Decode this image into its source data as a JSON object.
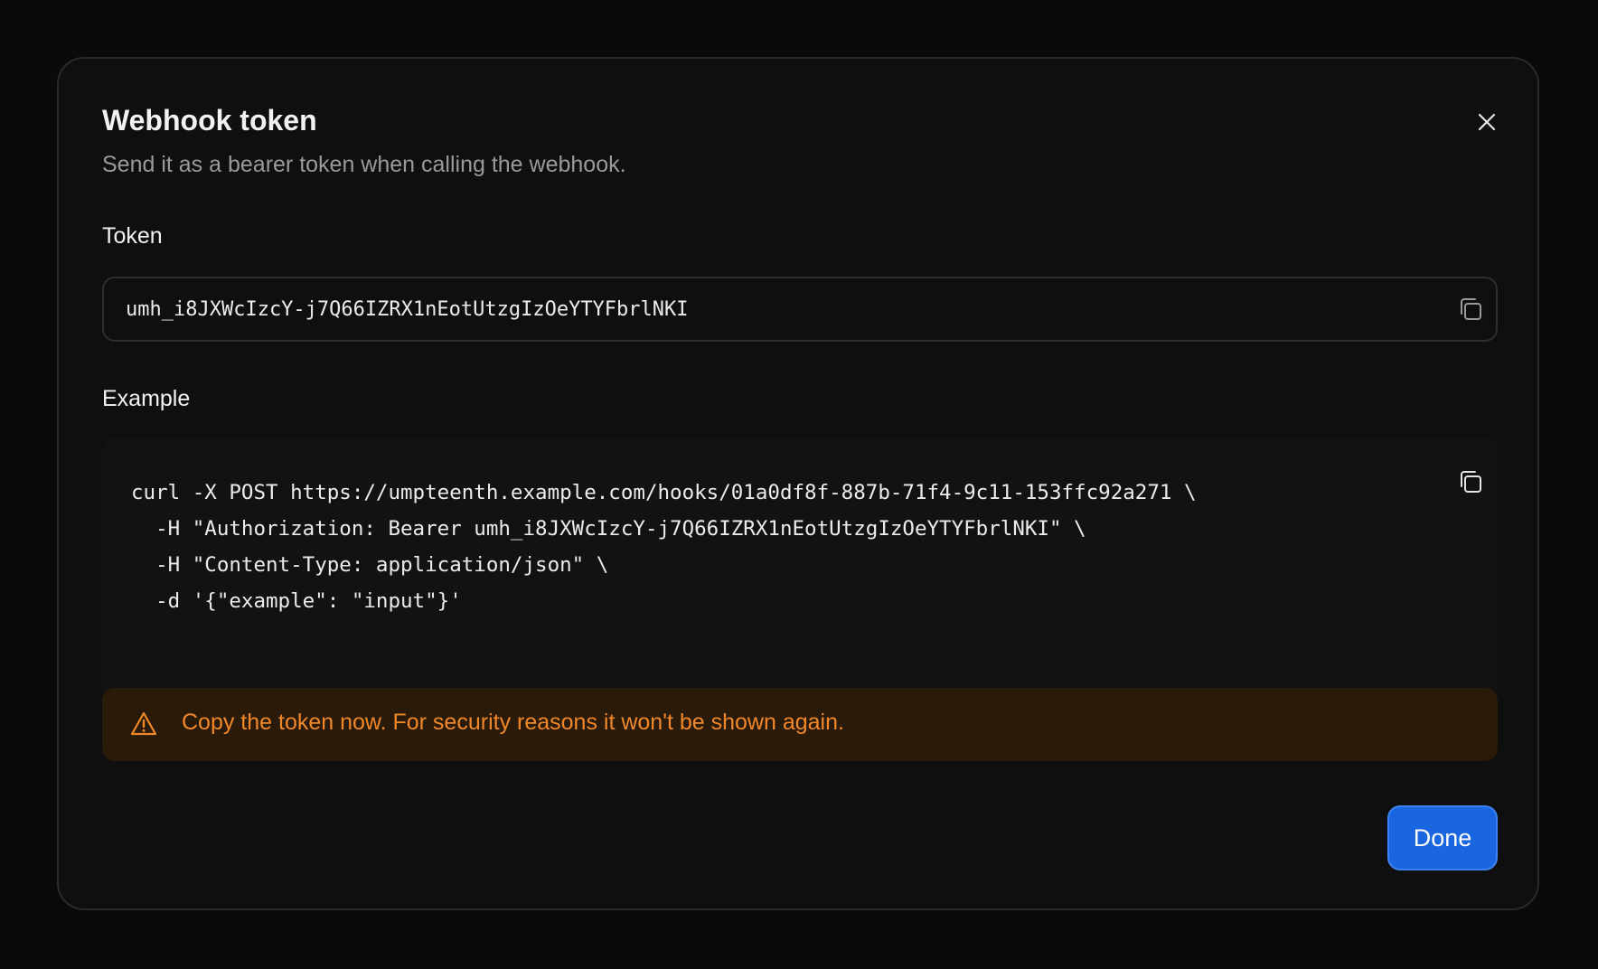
{
  "dialog": {
    "title": "Webhook token",
    "subtitle": "Send it as a bearer token when calling the webhook.",
    "close_icon": "close-icon"
  },
  "token": {
    "label": "Token",
    "value": "umh_i8JXWcIzcY-j7Q66IZRX1nEotUtzgIzOeYTYFbrlNKI",
    "copy_icon": "copy-icon"
  },
  "example": {
    "label": "Example",
    "lines": [
      "curl -X POST https://umpteenth.example.com/hooks/01a0df8f-887b-71f4-9c11-153ffc92a271 \\",
      "  -H \"Authorization: Bearer umh_i8JXWcIzcY-j7Q66IZRX1nEotUtzgIzOeYTYFbrlNKI\" \\",
      "  -H \"Content-Type: application/json\" \\",
      "  -d '{\"example\": \"input\"}'"
    ],
    "copy_icon": "copy-icon"
  },
  "warning": {
    "icon": "warning-icon",
    "text": "Copy the token now. For security reasons it won't be shown again."
  },
  "footer": {
    "done_label": "Done"
  },
  "colors": {
    "background": "#0a0a0a",
    "dialog_background": "#0f0f0f",
    "accent": "#1a66e0",
    "warning_text": "#f0882a",
    "warning_background": "#2a1a0a"
  }
}
